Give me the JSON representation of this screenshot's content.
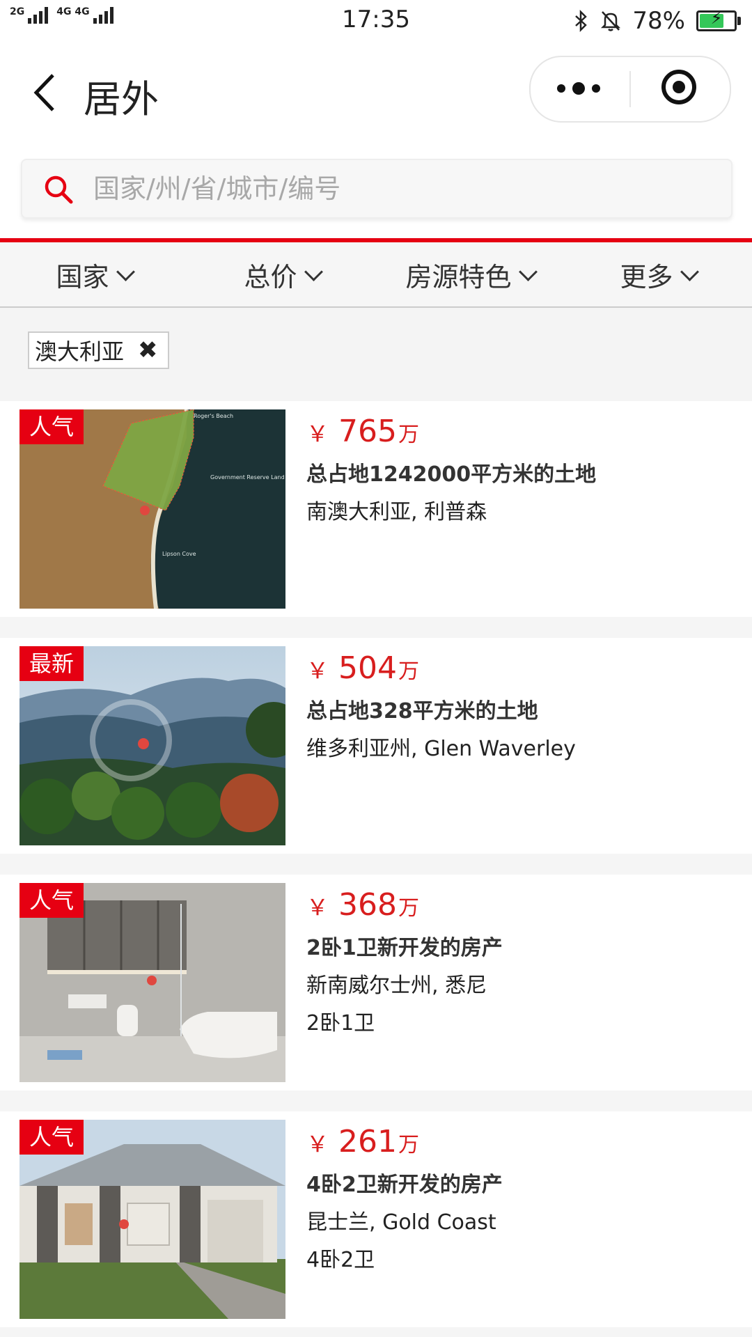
{
  "status_bar": {
    "signal_1": "2G",
    "signal_2": "4G 4G",
    "time": "17:35",
    "battery": "78%",
    "battery_level": 0.78,
    "icons": [
      "bluetooth-icon",
      "bell-muted-icon",
      "battery-charging-icon"
    ]
  },
  "nav": {
    "title": "居外"
  },
  "search": {
    "placeholder": "国家/州/省/城市/编号"
  },
  "filters": [
    {
      "label": "国家"
    },
    {
      "label": "总价"
    },
    {
      "label": "房源特色"
    },
    {
      "label": "更多"
    }
  ],
  "active_chip": {
    "label": "澳大利亚",
    "close": "✖"
  },
  "listings": [
    {
      "badge": "人气",
      "currency": "￥",
      "price": "765",
      "unit": "万",
      "title": "总占地1242000平方米的土地",
      "location": "南澳大利亚, 利普森",
      "rooms": "",
      "map_labels": [
        "Roger's Beach",
        "Government Reserve Land",
        "Lipson Cove"
      ]
    },
    {
      "badge": "最新",
      "currency": "￥",
      "price": "504",
      "unit": "万",
      "title": "总占地328平方米的土地",
      "location": "维多利亚州, Glen Waverley",
      "rooms": ""
    },
    {
      "badge": "人气",
      "currency": "￥",
      "price": "368",
      "unit": "万",
      "title": "2卧1卫新开发的房产",
      "location": "新南威尔士州, 悉尼",
      "rooms": "2卧1卫"
    },
    {
      "badge": "人气",
      "currency": "￥",
      "price": "261",
      "unit": "万",
      "title": "4卧2卫新开发的房产",
      "location": "昆士兰, Gold Coast",
      "rooms": "4卧2卫"
    }
  ],
  "colors": {
    "accent": "#e60012",
    "price": "#d81e1e"
  }
}
